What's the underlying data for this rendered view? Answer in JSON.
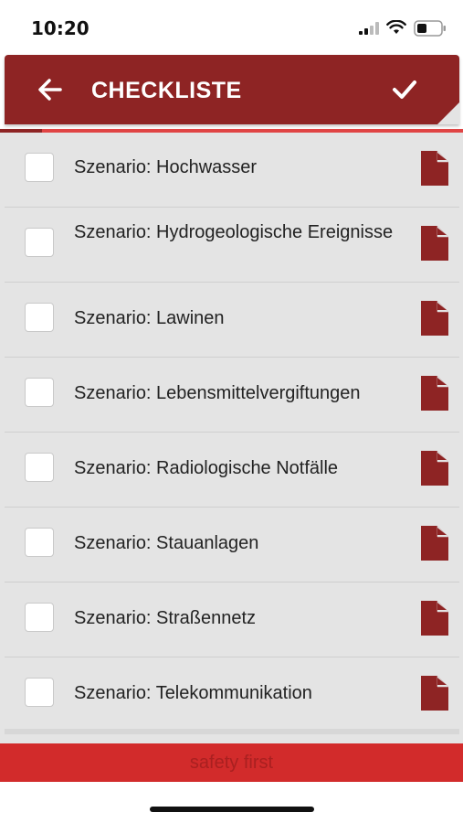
{
  "status_bar": {
    "time": "10:20"
  },
  "header": {
    "title": "CHECKLISTE",
    "back_icon": "arrow-left-icon",
    "confirm_icon": "checkmark-icon"
  },
  "progress": {
    "fraction": 0.09
  },
  "items": [
    {
      "label": "Szenario: Hochwasser",
      "checked": false
    },
    {
      "label": "Szenario: Hydrogeologische Ereignisse",
      "checked": false
    },
    {
      "label": "Szenario: Lawinen",
      "checked": false
    },
    {
      "label": "Szenario: Lebensmittelvergiftungen",
      "checked": false
    },
    {
      "label": "Szenario: Radiologische Notfälle",
      "checked": false
    },
    {
      "label": "Szenario: Stauanlagen",
      "checked": false
    },
    {
      "label": "Szenario: Straßennetz",
      "checked": false
    },
    {
      "label": "Szenario: Telekommunikation",
      "checked": false
    }
  ],
  "footer": {
    "text": "safety first"
  },
  "colors": {
    "brand": "#8e2424",
    "accent": "#d22b2b",
    "list_background": "#e4e4e4"
  }
}
